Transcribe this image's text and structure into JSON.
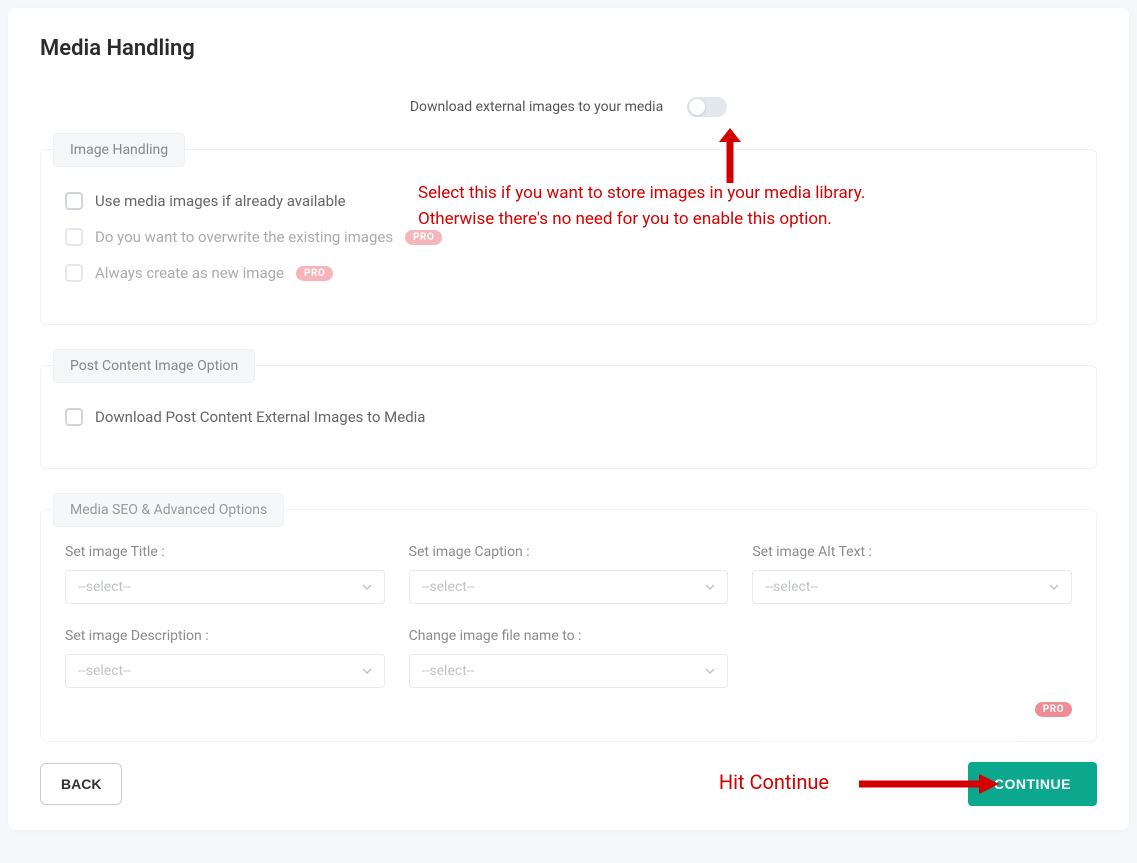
{
  "page_title": "Media Handling",
  "download_label": "Download external images to your media",
  "image_handling": {
    "legend": "Image Handling",
    "opt1": "Use media images if already available",
    "opt2": "Do you want to overwrite the existing images",
    "opt3": "Always create as new image",
    "pro": "PRO"
  },
  "post_content": {
    "legend": "Post Content Image Option",
    "opt1": "Download Post Content External Images to Media"
  },
  "seo": {
    "legend": "Media SEO & Advanced Options",
    "title": "Set image Title :",
    "caption": "Set image Caption :",
    "alt": "Set image Alt Text :",
    "desc": "Set image Description :",
    "filename": "Change image file name to :",
    "placeholder": "--select--",
    "pro": "PRO"
  },
  "back": "BACK",
  "continue": "CONTINUE",
  "annotation1": "Select this if you want to store images in your media library.\nOtherwise there's no need for you to enable this option.",
  "annotation2": "Hit Continue"
}
